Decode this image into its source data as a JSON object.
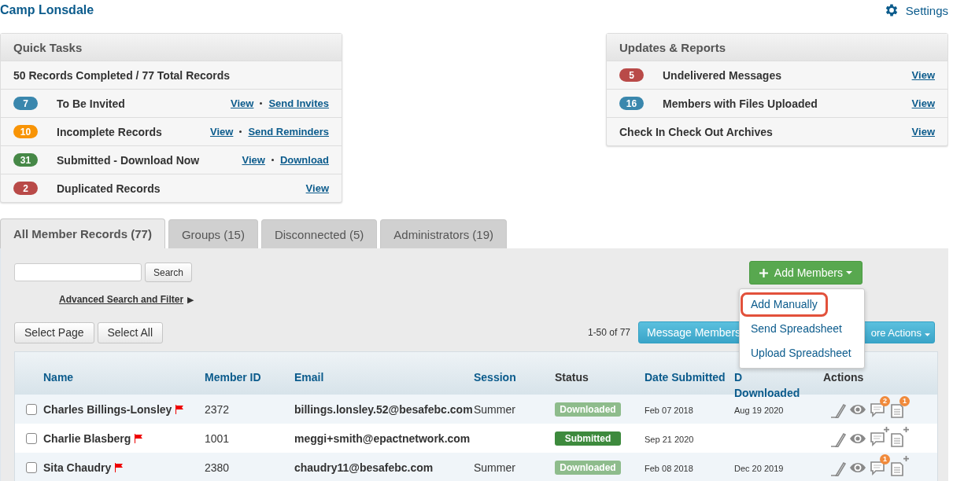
{
  "header": {
    "title": "Camp Lonsdale",
    "settings": "Settings"
  },
  "quick_tasks": {
    "title": "Quick Tasks",
    "summary": "50 Records Completed / 77 Total Records",
    "rows": [
      {
        "count": "7",
        "color": "#3a87ad",
        "label": "To Be Invited",
        "links": [
          "View",
          "Send Invites"
        ]
      },
      {
        "count": "10",
        "color": "#f89406",
        "label": "Incomplete Records",
        "links": [
          "View",
          "Send Reminders"
        ]
      },
      {
        "count": "31",
        "color": "#468847",
        "label": "Submitted - Download Now",
        "links": [
          "View",
          "Download"
        ]
      },
      {
        "count": "2",
        "color": "#b94a48",
        "label": "Duplicated Records",
        "links": [
          "View"
        ]
      }
    ]
  },
  "updates": {
    "title": "Updates & Reports",
    "rows": [
      {
        "count": "5",
        "color": "#b94a48",
        "label": "Undelivered Messages",
        "link": "View"
      },
      {
        "count": "16",
        "color": "#3a87ad",
        "label": "Members with Files Uploaded",
        "link": "View"
      },
      {
        "label": "Check In Check Out Archives",
        "link": "View"
      }
    ]
  },
  "tabs": [
    {
      "label": "All Member Records (77)",
      "selected": true
    },
    {
      "label": "Groups (15)",
      "selected": false
    },
    {
      "label": "Disconnected (5)",
      "selected": false
    },
    {
      "label": "Administrators (19)",
      "selected": false
    }
  ],
  "search": {
    "button": "Search",
    "advanced": "Advanced Search and Filter",
    "arrow": "▶"
  },
  "select_buttons": [
    "Select Page",
    "Select All"
  ],
  "add_members": {
    "label": "Add Members",
    "menu": [
      {
        "label": "Add Manually",
        "selected": true
      },
      {
        "label": "Send Spreadsheet",
        "selected": false
      },
      {
        "label": "Upload Spreadsheet",
        "selected": false
      }
    ]
  },
  "pagination": "1-50 of 77",
  "action_buttons": [
    "Message Members",
    "ore Actions"
  ],
  "table": {
    "columns": [
      {
        "lines": [
          "Name"
        ],
        "sortable": true
      },
      {
        "lines": [
          "Member ID"
        ],
        "sortable": true
      },
      {
        "lines": [
          "Email"
        ],
        "sortable": true
      },
      {
        "lines": [
          "Session"
        ],
        "sortable": true
      },
      {
        "lines": [
          "Status"
        ],
        "sortable": false
      },
      {
        "lines": [
          "Date Submitted"
        ],
        "sortable": true
      },
      {
        "lines": [
          "D",
          "Downloaded"
        ],
        "sortable": true
      },
      {
        "lines": [
          "Actions"
        ],
        "sortable": false
      }
    ],
    "rows": [
      {
        "checked": false,
        "name": "Charles Billings-Lonsley",
        "flagged": true,
        "member_id": "2372",
        "email": "billings.lonsley.52@besafebc.com",
        "session": "Summer",
        "status": {
          "label": "Downloaded",
          "kind": "downloaded"
        },
        "date_submitted": "Feb 07 2018",
        "date_downloaded": "Aug 19 2020",
        "comments": {
          "kind": "count",
          "count": "2"
        },
        "files": {
          "kind": "count",
          "count": "1"
        }
      },
      {
        "checked": false,
        "name": "Charlie Blasberg",
        "flagged": true,
        "member_id": "1001",
        "email": "meggi+smith@epactnetwork.com",
        "status": {
          "label": "Submitted",
          "kind": "submitted"
        },
        "date_submitted": "Sep 21 2020",
        "comments": {
          "kind": "add"
        },
        "files": {
          "kind": "add"
        }
      },
      {
        "checked": false,
        "name": "Sita Chaudry",
        "flagged": true,
        "member_id": "2380",
        "email": "chaudry11@besafebc.com",
        "session": "Summer",
        "status": {
          "label": "Downloaded",
          "kind": "downloaded"
        },
        "date_submitted": "Feb 08 2018",
        "date_downloaded": "Dec 20 2019",
        "comments": {
          "kind": "count",
          "count": "1"
        },
        "files": {
          "kind": "add"
        }
      }
    ]
  }
}
